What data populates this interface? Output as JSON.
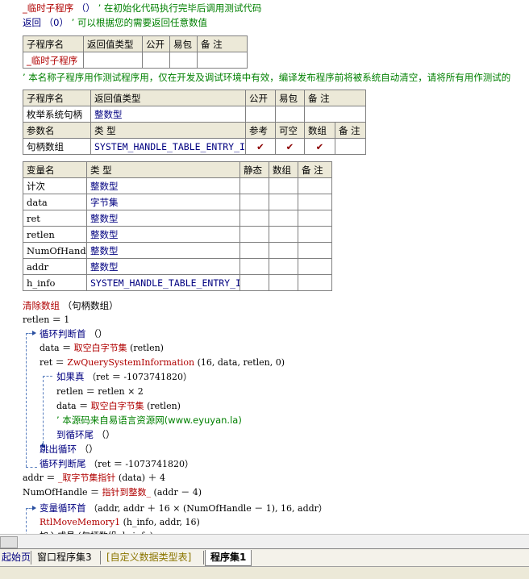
{
  "code": {
    "l1_name": "_临时子程序",
    "l1_paren": "（）",
    "l1_comment": "’ 在初始化代码执行完毕后调用测试代码",
    "l2_kw": "返回",
    "l2_arg": "（0）",
    "l2_comment": "’ 可以根据您的需要返回任意数值",
    "comment_long": "’ 本名称子程序用作测试程序用，仅在开发及调试环境中有效，编译发布程序前将被系统自动清空，请将所有用作测试的",
    "l_clear_fn": "清除数组",
    "l_clear_arg": "（句柄数组）",
    "l_retlen": "retlen ＝ 1",
    "l_loop_head": "循环判断首",
    "l_loop_head_paren": "（）",
    "l_data_a": "data ＝ ",
    "l_data_fn": "取空白字节集",
    "l_data_args": " (retlen)",
    "l_ret_a": "ret ＝ ",
    "l_ret_fn": "ZwQuerySystemInformation",
    "l_ret_args": " (16, data, retlen, 0)",
    "l_if": "如果真",
    "l_if_args": "（ret ＝ -1073741820）",
    "l_retlen2": "retlen ＝ retlen × 2",
    "l_data2_a": "data ＝ ",
    "l_data2_fn": "取空白字节集",
    "l_data2_args": " (retlen)",
    "l_comment_src": "’ 本源码来自易语言资源网(www.eyuyan.la)",
    "l_to_loop_end": "到循环尾",
    "l_to_loop_end_paren": "（）",
    "l_break": "跳出循环",
    "l_break_paren": "（）",
    "l_loop_tail": "循环判断尾",
    "l_loop_tail_args": "（ret ＝ -1073741820）",
    "l_addr_a": "addr ＝ ",
    "l_addr_fn": "_取字节集指针",
    "l_addr_args": " (data) ＋ 4",
    "l_num_a": "NumOfHandle ＝ ",
    "l_num_fn": "指针到整数_",
    "l_num_args": " (addr － 4)",
    "l_var_loop": "变量循环首",
    "l_var_loop_args": "（addr, addr ＋ 16 × (NumOfHandle － 1), 16, addr）",
    "l_rtl": "RtlMoveMemory1",
    "l_rtl_args": " (h_info, addr, 16)",
    "l_partial": "加入成员 (句柄数组, h_info)"
  },
  "table1": {
    "headers": [
      "子程序名",
      "返回值类型",
      "公开",
      "易包",
      "备 注"
    ],
    "row": [
      "_临时子程序",
      "",
      "",
      "",
      ""
    ]
  },
  "table2": {
    "headers": [
      "子程序名",
      "返回值类型",
      "公开",
      "易包",
      "备 注"
    ],
    "row": [
      "枚举系统句柄",
      "整数型",
      "",
      "",
      ""
    ],
    "param_headers": [
      "参数名",
      "类 型",
      "参考",
      "可空",
      "数组",
      "备 注"
    ],
    "param_row": [
      "句柄数组",
      "SYSTEM_HANDLE_TABLE_ENTRY_INFO",
      "✔",
      "✔",
      "✔",
      ""
    ]
  },
  "table3": {
    "headers": [
      "变量名",
      "类 型",
      "静态",
      "数组",
      "备 注"
    ],
    "rows": [
      [
        "计次",
        "整数型"
      ],
      [
        "data",
        "字节集"
      ],
      [
        "ret",
        "整数型"
      ],
      [
        "retlen",
        "整数型"
      ],
      [
        "NumOfHandle",
        "整数型"
      ],
      [
        "addr",
        "整数型"
      ],
      [
        "h_info",
        "SYSTEM_HANDLE_TABLE_ENTRY_INFO"
      ]
    ]
  },
  "tabs": [
    {
      "label": "起始页"
    },
    {
      "label": "窗口程序集3"
    },
    {
      "label": "[自定义数据类型表]"
    },
    {
      "label": "程序集1"
    }
  ],
  "colors": {
    "keyword": "#b00000",
    "comment": "#008000",
    "type": "#000080"
  }
}
